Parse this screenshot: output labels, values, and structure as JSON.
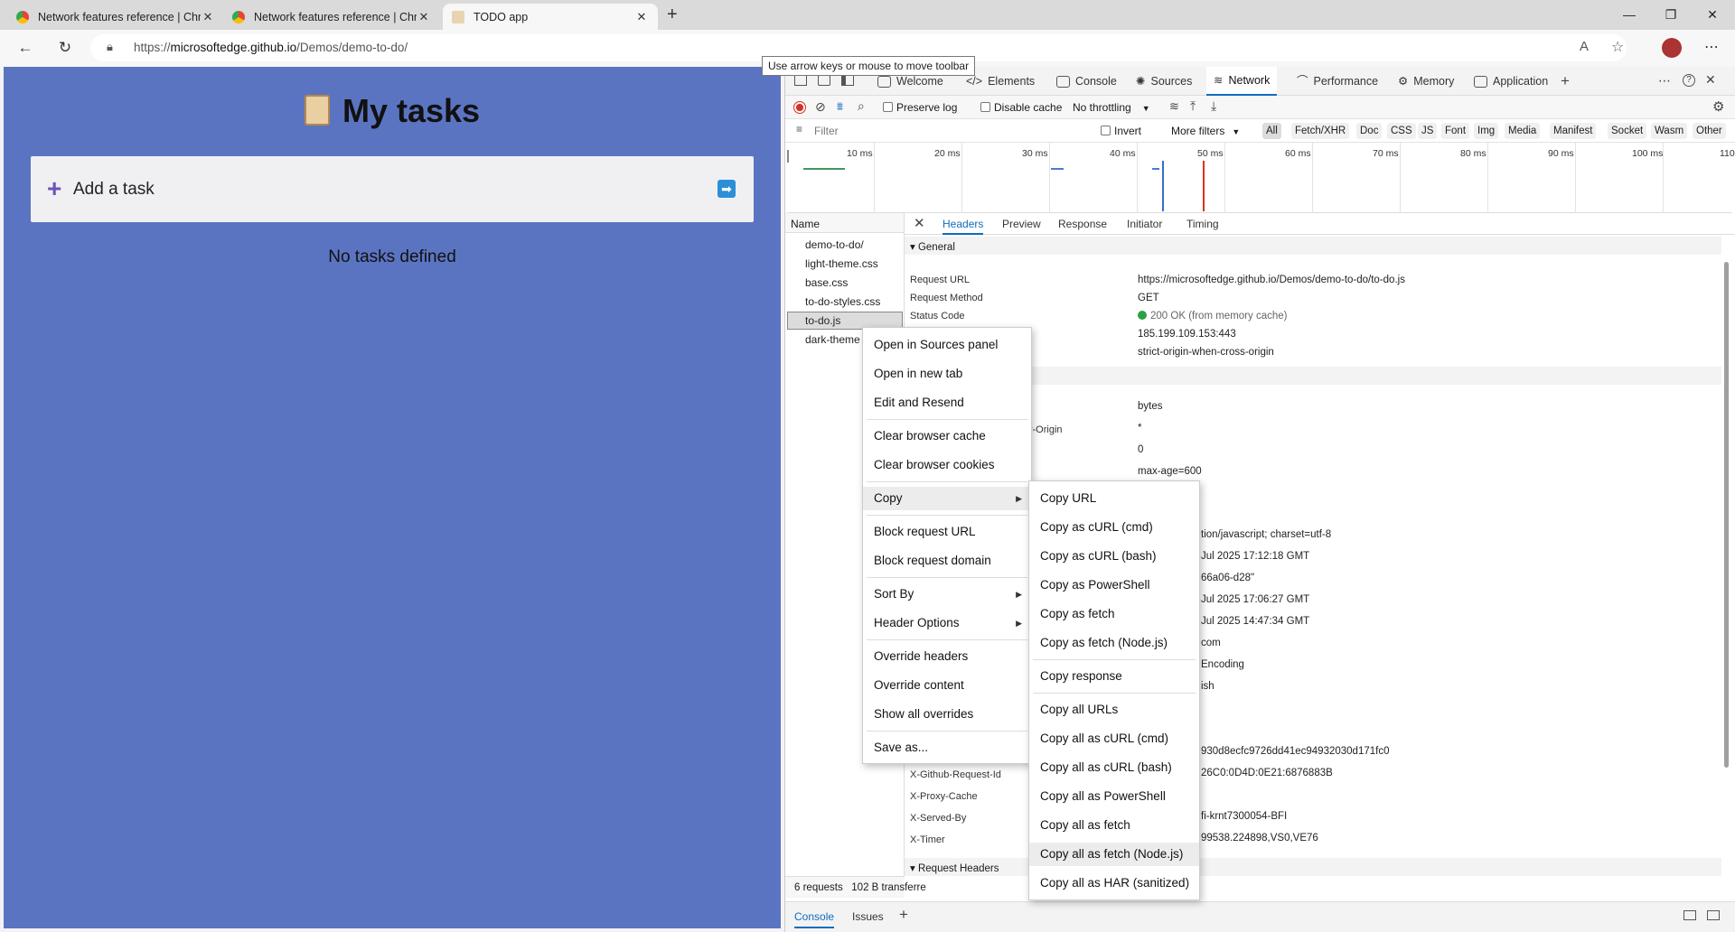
{
  "browser": {
    "tabs": [
      {
        "title": "Network features reference | Chr",
        "favicon": "chrome-icon"
      },
      {
        "title": "Network features reference | Chr",
        "favicon": "chrome-icon"
      },
      {
        "title": "TODO app",
        "favicon": "clipboard-icon"
      }
    ],
    "url_prefix": "https://",
    "url_host": "microsoftedge.github.io",
    "url_path": "/Demos/demo-to-do/",
    "tooltip": "Use arrow keys or mouse to move toolbar"
  },
  "page": {
    "title": "My tasks",
    "add_task_label": "Add a task",
    "empty_message": "No tasks defined"
  },
  "devtools": {
    "tabs": [
      "Welcome",
      "Elements",
      "Console",
      "Sources",
      "Network",
      "Performance",
      "Memory",
      "Application"
    ],
    "active_tab": "Network",
    "toolbar": {
      "preserve_log": "Preserve log",
      "disable_cache": "Disable cache",
      "throttling": "No throttling"
    },
    "filter": {
      "placeholder": "Filter",
      "invert": "Invert",
      "more_filters": "More filters",
      "types": [
        "All",
        "Fetch/XHR",
        "Doc",
        "CSS",
        "JS",
        "Font",
        "Img",
        "Media",
        "Manifest",
        "Socket",
        "Wasm",
        "Other"
      ]
    },
    "timeline_ticks": [
      "10 ms",
      "20 ms",
      "30 ms",
      "40 ms",
      "50 ms",
      "60 ms",
      "70 ms",
      "80 ms",
      "90 ms",
      "100 ms",
      "110"
    ],
    "requests_header": "Name",
    "requests": [
      "demo-to-do/",
      "light-theme.css",
      "base.css",
      "to-do-styles.css",
      "to-do.js",
      "dark-theme"
    ],
    "selected_request": "to-do.js",
    "status_bar": "6 requests   102 B transferre",
    "detail_tabs": [
      "Headers",
      "Preview",
      "Response",
      "Initiator",
      "Timing"
    ],
    "general": {
      "section": "General",
      "labels": [
        "Request URL",
        "Request Method",
        "Status Code"
      ],
      "values": [
        "https://microsoftedge.github.io/Demos/demo-to-do/to-do.js",
        "GET",
        "200 OK (from memory cache)",
        "185.199.109.153:443",
        "strict-origin-when-cross-origin"
      ]
    },
    "response_partial": {
      "section_tail": "s",
      "labels": [
        "v-Origin"
      ],
      "values": [
        "bytes",
        "*",
        "0",
        "max-age=600",
        "tion/javascript; charset=utf-8",
        "Jul 2025 17:12:18 GMT",
        "66a06-d28\"",
        "Jul 2025 17:06:27 GMT",
        "Jul 2025 14:47:34 GMT",
        "com",
        "Encoding",
        "ish",
        "930d8ecfc9726dd41ec94932030d171fc0",
        "26C0:0D4D:0E21:6876883B",
        "fi-krnt7300054-BFI",
        "99538.224898,VS0,VE76"
      ],
      "bottom_labels": [
        "X-Github-Request-Id",
        "X-Proxy-Cache",
        "X-Served-By",
        "X-Timer"
      ]
    },
    "request_headers": "Request Headers",
    "drawer_tabs": [
      "Console",
      "Issues"
    ]
  },
  "context_menu": {
    "items": [
      "Open in Sources panel",
      "Open in new tab",
      "Edit and Resend",
      "Clear browser cache",
      "Clear browser cookies",
      "Copy",
      "Block request URL",
      "Block request domain",
      "Sort By",
      "Header Options",
      "Override headers",
      "Override content",
      "Show all overrides",
      "Save as..."
    ]
  },
  "copy_submenu": {
    "items": [
      "Copy URL",
      "Copy as cURL (cmd)",
      "Copy as cURL (bash)",
      "Copy as PowerShell",
      "Copy as fetch",
      "Copy as fetch (Node.js)",
      "Copy response",
      "Copy all URLs",
      "Copy all as cURL (cmd)",
      "Copy all as cURL (bash)",
      "Copy all as PowerShell",
      "Copy all as fetch",
      "Copy all as fetch (Node.js)",
      "Copy all as HAR (sanitized)"
    ],
    "highlighted": "Copy all as fetch (Node.js)"
  },
  "colors": {
    "page_bg": "#5b74c2",
    "accent": "#0f6cbd",
    "record": "#d93025",
    "status_ok": "#2ea043"
  }
}
